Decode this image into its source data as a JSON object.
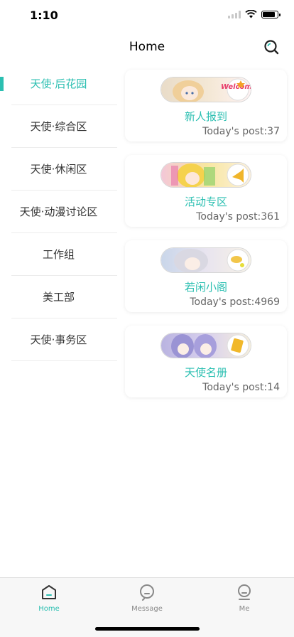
{
  "status": {
    "time": "1:10"
  },
  "nav": {
    "title": "Home",
    "search_icon": "search-icon"
  },
  "sidebar": {
    "items": [
      {
        "label": "天使·后花园",
        "active": true
      },
      {
        "label": "天使·综合区",
        "active": false
      },
      {
        "label": "天使·休闲区",
        "active": false
      },
      {
        "label": "天使·动漫讨论区",
        "active": false
      },
      {
        "label": "工作组",
        "active": false
      },
      {
        "label": "美工部",
        "active": false
      },
      {
        "label": "天使·事务区",
        "active": false
      }
    ]
  },
  "forums": [
    {
      "name": "新人报到",
      "posts": "Today's post:37",
      "badge_text": "Welcome"
    },
    {
      "name": "活动专区",
      "posts": "Today's post:361"
    },
    {
      "name": "若闲小阁",
      "posts": "Today's post:4969"
    },
    {
      "name": "天使名册",
      "posts": "Today's post:14"
    }
  ],
  "tabs": [
    {
      "label": "Home",
      "icon": "home-icon",
      "active": true
    },
    {
      "label": "Message",
      "icon": "message-icon",
      "active": false
    },
    {
      "label": "Me",
      "icon": "user-icon",
      "active": false
    }
  ],
  "colors": {
    "accent": "#2bbfb1",
    "text": "#333333",
    "muted": "#666666"
  }
}
